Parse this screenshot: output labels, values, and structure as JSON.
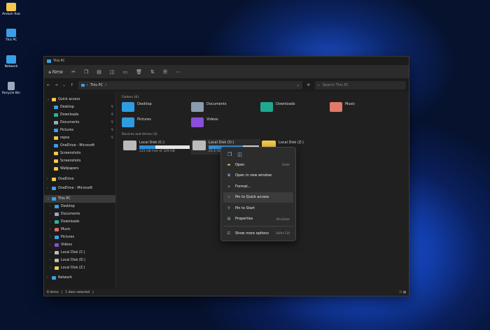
{
  "desktop": {
    "icons": [
      {
        "label": "Anduin Xue",
        "color": "#f2c94c"
      },
      {
        "label": "This PC",
        "color": "#3aa0e6"
      },
      {
        "label": "Network",
        "color": "#3aa0e6"
      },
      {
        "label": "Recycle Bin",
        "color": "#9ab"
      }
    ]
  },
  "window": {
    "title": "This PC",
    "toolbar": {
      "new_label": "New"
    },
    "address": {
      "path": "This PC",
      "search_placeholder": "Search This PC"
    },
    "sidebar": {
      "quick_access": "Quick access",
      "quick_items": [
        {
          "label": "Desktop",
          "color": "#3aa0e6",
          "pinned": true
        },
        {
          "label": "Downloads",
          "color": "#2bb59a",
          "pinned": true
        },
        {
          "label": "Documents",
          "color": "#9ab",
          "pinned": true
        },
        {
          "label": "Pictures",
          "color": "#3aa0e6",
          "pinned": true
        },
        {
          "label": "repos",
          "color": "#f2c94c",
          "pinned": true
        },
        {
          "label": "OneDrive - Microsoft",
          "color": "#3aa0e6",
          "pinned": false
        },
        {
          "label": "Screenshots",
          "color": "#f2c94c",
          "pinned": false
        },
        {
          "label": "Screenshots",
          "color": "#f2c94c",
          "pinned": false
        },
        {
          "label": "Wallpapers",
          "color": "#f2c94c",
          "pinned": false
        }
      ],
      "onedrive": "OneDrive",
      "onedrive_ms": "OneDrive - Microsoft",
      "this_pc": "This PC",
      "pc_items": [
        {
          "label": "Desktop",
          "color": "#3aa0e6"
        },
        {
          "label": "Documents",
          "color": "#9ab"
        },
        {
          "label": "Downloads",
          "color": "#2bb59a"
        },
        {
          "label": "Music",
          "color": "#e06a6a"
        },
        {
          "label": "Pictures",
          "color": "#3aa0e6"
        },
        {
          "label": "Videos",
          "color": "#8a4fd8"
        },
        {
          "label": "Local Disk (C:)",
          "color": "#bbb"
        },
        {
          "label": "Local Disk (D:)",
          "color": "#bbb"
        },
        {
          "label": "Local Disk (Z:)",
          "color": "#f2c94c"
        }
      ],
      "network": "Network"
    },
    "folders_header": "Folders (6)",
    "folders": [
      {
        "label": "Desktop",
        "color": "#2f9be0"
      },
      {
        "label": "Documents",
        "color": "#8a9bb0"
      },
      {
        "label": "Downloads",
        "color": "#1fa88f"
      },
      {
        "label": "Music",
        "color": "#e07a6a"
      },
      {
        "label": "Pictures",
        "color": "#2f9be0"
      },
      {
        "label": "Videos",
        "color": "#8a4fd8"
      }
    ],
    "drives_header": "Devices and drives (3)",
    "drives": [
      {
        "label": "Local Disk (C:)",
        "free": "225 GB free of 329 GB",
        "used_fraction": 0.32,
        "color": "#bbb"
      },
      {
        "label": "Local Disk (D:)",
        "free": "25.4 GB fre",
        "used_fraction": 0.68,
        "color": "#bbb"
      },
      {
        "label": "Local Disk (Z:)",
        "color": "#f2c94c"
      }
    ],
    "status": {
      "items": "6 items",
      "selected": "1 item selected"
    }
  },
  "context_menu": {
    "items": [
      {
        "label": "Open",
        "shortcut": "Enter",
        "icon": "folder-icon"
      },
      {
        "label": "Open in new window",
        "shortcut": "",
        "icon": "new-window-icon"
      },
      {
        "label": "Format...",
        "shortcut": "",
        "icon": "format-icon"
      },
      {
        "label": "Pin to Quick access",
        "shortcut": "",
        "icon": "star-icon"
      },
      {
        "label": "Pin to Start",
        "shortcut": "",
        "icon": "pin-icon"
      },
      {
        "label": "Properties",
        "shortcut": "Alt+Enter",
        "icon": "properties-icon"
      },
      {
        "label": "Show more options",
        "shortcut": "Shift+F10",
        "icon": "more-options-icon"
      }
    ]
  }
}
